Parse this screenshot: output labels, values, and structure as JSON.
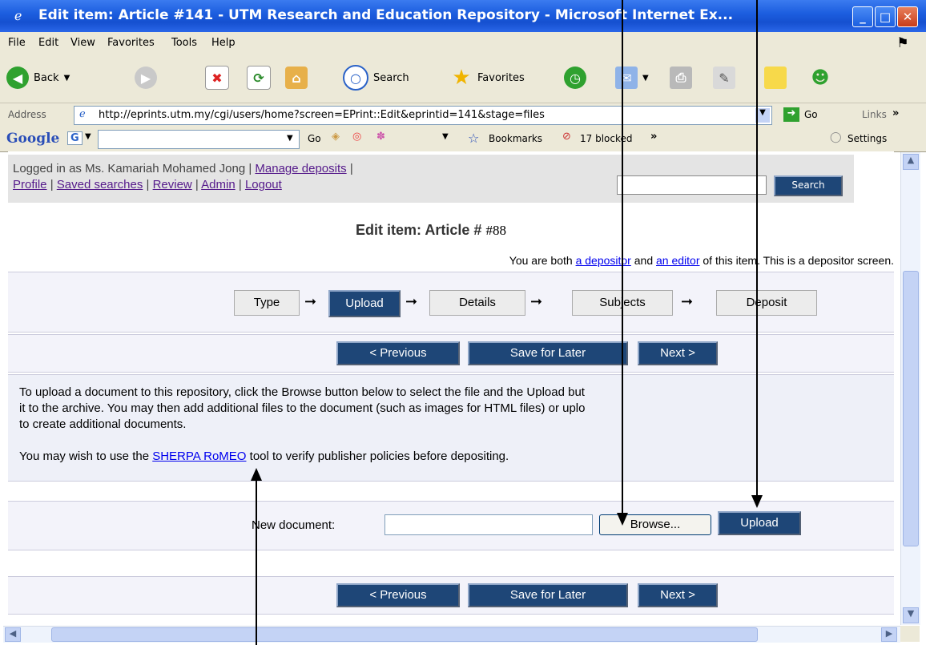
{
  "window": {
    "title": "Edit item: Article #141 - UTM Research and Education Repository - Microsoft Internet Ex...",
    "minimize": "_",
    "maximize": "□",
    "close": "✕"
  },
  "menu": [
    "File",
    "Edit",
    "View",
    "Favorites",
    "Tools",
    "Help"
  ],
  "toolbar": {
    "back": "Back",
    "search": "Search",
    "favorites": "Favorites"
  },
  "address": {
    "label": "Address",
    "url": "http://eprints.utm.my/cgi/users/home?screen=EPrint::Edit&eprintid=141&stage=files",
    "go": "Go",
    "links": "Links"
  },
  "google": {
    "logo": "Google",
    "g_button": "G",
    "go": "Go",
    "bookmarks": "Bookmarks",
    "blocked": "17 blocked",
    "settings": "Settings"
  },
  "header": {
    "logged_in": "Logged in as Ms. Kamariah Mohamed Jong |",
    "manage_deposits": "Manage deposits",
    "sep": "|",
    "profile": "Profile",
    "saved_searches": "Saved searches",
    "review": "Review",
    "admin": "Admin",
    "logout": "Logout",
    "search_button": "Search"
  },
  "page": {
    "title": "Edit item: Article #",
    "annotation_number": "#88",
    "role_prefix": "You are both",
    "depositor_link": "a depositor",
    "and": "and",
    "editor_link": "an editor",
    "role_suffix": "of this item. This is a depositor screen."
  },
  "steps": [
    "Type",
    "Upload",
    "Details",
    "Subjects",
    "Deposit"
  ],
  "nav": {
    "previous": "< Previous",
    "save_later": "Save for Later",
    "next": "Next >"
  },
  "help": {
    "line1": "To upload a document to this repository, click the Browse button below to select the file and the Upload but",
    "line2": "it to the archive. You may then add additional files to the document (such as images for HTML files) or uplo",
    "line3": "to create additional documents.",
    "line4_prefix": "You may wish to use the",
    "sherpa": "SHERPA RoMEO",
    "line4_suffix": "tool to verify publisher policies before depositing."
  },
  "upload": {
    "label": "New document:",
    "browse": "Browse...",
    "upload": "Upload"
  }
}
